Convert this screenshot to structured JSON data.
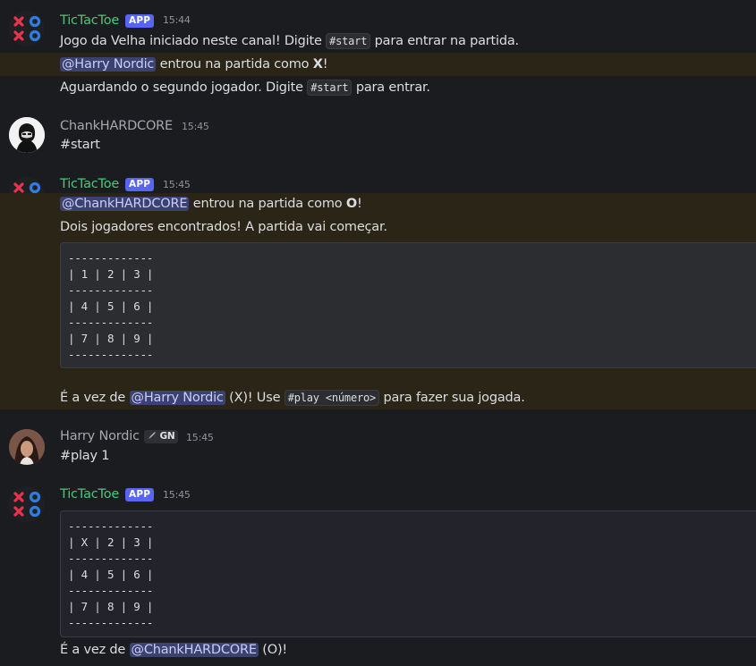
{
  "messages": [
    {
      "author": "TicTacToe",
      "badge": "APP",
      "time": "15:44",
      "lines": {
        "l1_pre": "Jogo da Velha iniciado neste canal! Digite ",
        "l1_code": "#start",
        "l1_post": " para entrar na partida.",
        "l2_mention": "@Harry Nordic",
        "l2_mid": " entrou na partida como ",
        "l2_bold": "X",
        "l2_post": "!",
        "l3_pre": "Aguardando o segundo jogador. Digite ",
        "l3_code": "#start",
        "l3_post": " para entrar."
      }
    },
    {
      "author": "ChankHARDCORE",
      "time": "15:45",
      "text": "#start"
    },
    {
      "author": "TicTacToe",
      "badge": "APP",
      "time": "15:45",
      "lines": {
        "l1_mention": "@ChankHARDCORE",
        "l1_mid": " entrou na partida como ",
        "l1_bold": "O",
        "l1_post": "!",
        "l2": "Dois jogadores encontrados! A partida vai começar.",
        "board": "-------------\n| 1 | 2 | 3 |\n-------------\n| 4 | 5 | 6 |\n-------------\n| 7 | 8 | 9 |\n-------------",
        "l3_pre": "É a vez de ",
        "l3_mention": "@Harry Nordic",
        "l3_mid": " (X)! Use ",
        "l3_code": "#play <número>",
        "l3_post": " para fazer sua jogada."
      }
    },
    {
      "author": "Harry Nordic",
      "badge": "GN",
      "time": "15:45",
      "text": "#play 1"
    },
    {
      "author": "TicTacToe",
      "badge": "APP",
      "time": "15:45",
      "lines": {
        "board": "-------------\n| X | 2 | 3 |\n-------------\n| 4 | 5 | 6 |\n-------------\n| 7 | 8 | 9 |\n-------------",
        "l1_pre": "É a vez de ",
        "l1_mention": "@ChankHARDCORE",
        "l1_post": " (O)!"
      }
    }
  ]
}
